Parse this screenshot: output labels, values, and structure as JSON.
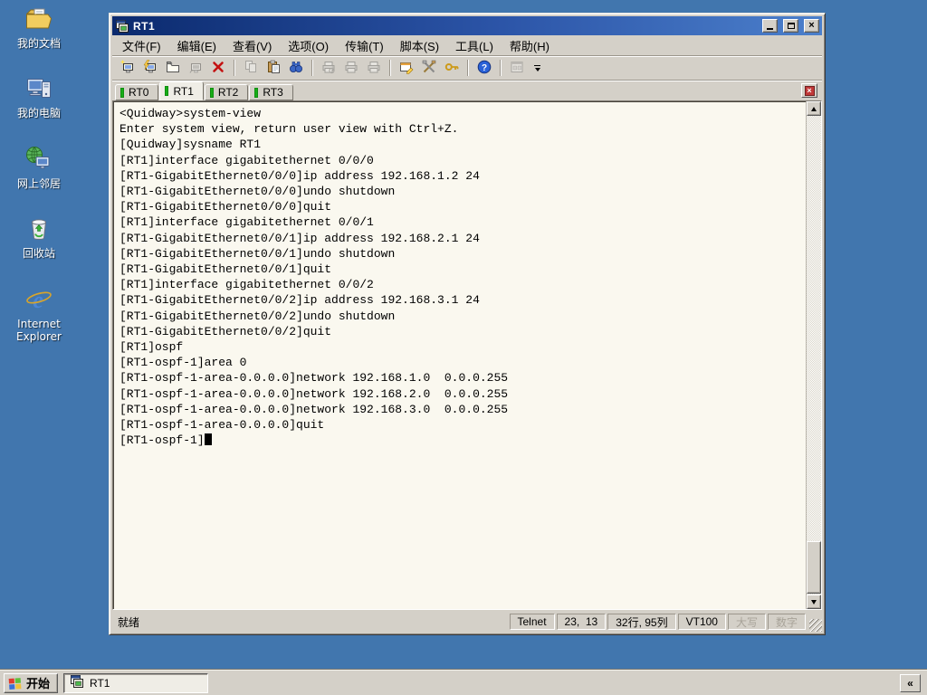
{
  "desktop": {
    "icons": [
      {
        "name": "my-documents",
        "label": "我的文档"
      },
      {
        "name": "my-computer",
        "label": "我的电脑"
      },
      {
        "name": "network-places",
        "label": "网上邻居"
      },
      {
        "name": "recycle-bin",
        "label": "回收站"
      },
      {
        "name": "internet-explorer",
        "label": "Internet Explorer"
      }
    ]
  },
  "window": {
    "title": "RT1",
    "menu": [
      {
        "name": "file",
        "label": "文件(F)"
      },
      {
        "name": "edit",
        "label": "编辑(E)"
      },
      {
        "name": "view",
        "label": "查看(V)"
      },
      {
        "name": "options",
        "label": "选项(O)"
      },
      {
        "name": "transfer",
        "label": "传输(T)"
      },
      {
        "name": "script",
        "label": "脚本(S)"
      },
      {
        "name": "tools",
        "label": "工具(L)"
      },
      {
        "name": "help",
        "label": "帮助(H)"
      }
    ],
    "toolbar": [
      {
        "name": "connect",
        "enabled": true
      },
      {
        "name": "quick-connect",
        "enabled": true
      },
      {
        "name": "connect-in-tab",
        "enabled": true
      },
      {
        "name": "reconnect",
        "enabled": false
      },
      {
        "name": "disconnect",
        "enabled": true
      },
      {
        "name": "separator"
      },
      {
        "name": "copy",
        "enabled": false
      },
      {
        "name": "paste",
        "enabled": true
      },
      {
        "name": "find",
        "enabled": true
      },
      {
        "name": "separator"
      },
      {
        "name": "print-preview",
        "enabled": false
      },
      {
        "name": "print-selection",
        "enabled": false
      },
      {
        "name": "print",
        "enabled": false
      },
      {
        "name": "separator"
      },
      {
        "name": "session-options",
        "enabled": true
      },
      {
        "name": "global-options",
        "enabled": true
      },
      {
        "name": "keymap",
        "enabled": true
      },
      {
        "name": "separator"
      },
      {
        "name": "help",
        "enabled": true
      },
      {
        "name": "separator"
      },
      {
        "name": "session-manager",
        "enabled": false
      },
      {
        "name": "toolbar-overflow",
        "enabled": true
      }
    ],
    "tabs": [
      {
        "label": "RT0",
        "active": false
      },
      {
        "label": "RT1",
        "active": true
      },
      {
        "label": "RT2",
        "active": false
      },
      {
        "label": "RT3",
        "active": false
      }
    ],
    "terminal": {
      "cursor": true,
      "lines": [
        "<Quidway>system-view",
        "Enter system view, return user view with Ctrl+Z.",
        "[Quidway]sysname RT1",
        "[RT1]interface gigabitethernet 0/0/0",
        "[RT1-GigabitEthernet0/0/0]ip address 192.168.1.2 24",
        "[RT1-GigabitEthernet0/0/0]undo shutdown",
        "[RT1-GigabitEthernet0/0/0]quit",
        "[RT1]interface gigabitethernet 0/0/1",
        "[RT1-GigabitEthernet0/0/1]ip address 192.168.2.1 24",
        "[RT1-GigabitEthernet0/0/1]undo shutdown",
        "[RT1-GigabitEthernet0/0/1]quit",
        "[RT1]interface gigabitethernet 0/0/2",
        "[RT1-GigabitEthernet0/0/2]ip address 192.168.3.1 24",
        "[RT1-GigabitEthernet0/0/2]undo shutdown",
        "[RT1-GigabitEthernet0/0/2]quit",
        "[RT1]ospf",
        "[RT1-ospf-1]area 0",
        "[RT1-ospf-1-area-0.0.0.0]network 192.168.1.0  0.0.0.255",
        "[RT1-ospf-1-area-0.0.0.0]network 192.168.2.0  0.0.0.255",
        "[RT1-ospf-1-area-0.0.0.0]network 192.168.3.0  0.0.0.255",
        "[RT1-ospf-1-area-0.0.0.0]quit",
        "[RT1-ospf-1]"
      ]
    },
    "status": {
      "message": "就绪",
      "panels": [
        {
          "name": "protocol",
          "text": "Telnet",
          "disabled": false
        },
        {
          "name": "cursor-position",
          "text": "23,  13",
          "disabled": false
        },
        {
          "name": "terminal-size",
          "text": "32行, 95列",
          "disabled": false
        },
        {
          "name": "emulation",
          "text": "VT100",
          "disabled": false
        },
        {
          "name": "caps-lock",
          "text": "大写",
          "disabled": true
        },
        {
          "name": "num-lock",
          "text": "数字",
          "disabled": true
        }
      ]
    }
  },
  "taskbar": {
    "start_label": "开始",
    "tasks": [
      {
        "name": "rt1",
        "label": "RT1",
        "active": true
      }
    ],
    "tray_collapse_label": "«"
  },
  "colors": {
    "desktop_background": "#4176AE",
    "titlebar_gradient_start": "#0B2A6E",
    "titlebar_gradient_end": "#4B7FCB",
    "window_chrome": "#D4D0C8",
    "terminal_background": "#FAF8EF",
    "terminal_text": "#000000",
    "tab_connected_indicator": "#17AD17",
    "tab_close_red": "#C03838"
  }
}
